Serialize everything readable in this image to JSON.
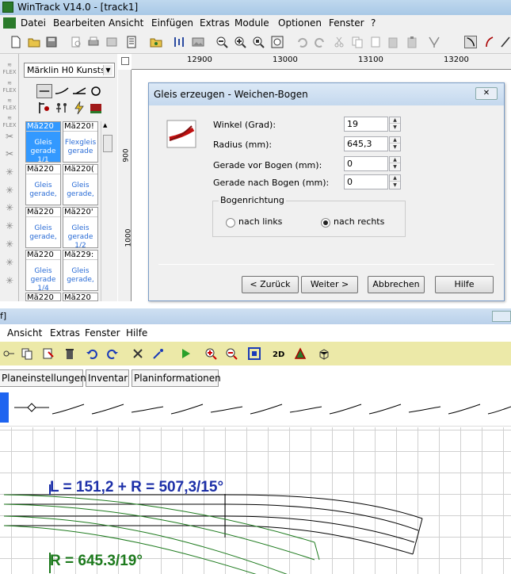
{
  "window": {
    "title": "WinTrack  V14.0 - [track1]"
  },
  "menubar": {
    "items": [
      "Datei",
      "Bearbeiten",
      "Ansicht",
      "Einfügen",
      "Extras",
      "Module",
      "Optionen",
      "Fenster",
      "?"
    ]
  },
  "library": {
    "combo_value": "Märklin H0 Kunstst",
    "tiles": [
      {
        "name": "Mä220",
        "desc": "Gleis gerade 1/1"
      },
      {
        "name": "Mä220!",
        "desc": "Flexgleis gerade"
      },
      {
        "name": "Mä220",
        "desc": "Gleis gerade,"
      },
      {
        "name": "Mä220(",
        "desc": "Gleis gerade,"
      },
      {
        "name": "Mä220",
        "desc": "Gleis gerade,"
      },
      {
        "name": "Mä220'",
        "desc": "Gleis gerade 1/2"
      },
      {
        "name": "Mä220",
        "desc": "Gleis gerade 1/4"
      },
      {
        "name": "Mä229:",
        "desc": "Gleis gerade,"
      },
      {
        "name": "Mä220",
        "desc": ""
      },
      {
        "name": "Mä220",
        "desc": ""
      }
    ]
  },
  "ruler": {
    "h": [
      "12900",
      "13000",
      "13100",
      "13200"
    ],
    "v": [
      "900",
      "1000"
    ]
  },
  "dialog": {
    "title": "Gleis erzeugen - Weichen-Bogen",
    "fields": [
      {
        "label": "Winkel (Grad):",
        "value": "19"
      },
      {
        "label": "Radius (mm):",
        "value": "645,3"
      },
      {
        "label": "Gerade vor Bogen (mm):",
        "value": "0"
      },
      {
        "label": "Gerade nach Bogen (mm):",
        "value": "0"
      }
    ],
    "group_label": "Bogenrichtung",
    "radio_left": "nach links",
    "radio_right": "nach rechts",
    "radio_selected": "nach rechts",
    "buttons": {
      "back": "< Zurück",
      "next": "Weiter >",
      "cancel": "Abbrechen",
      "help": "Hilfe"
    }
  },
  "window2": {
    "title_fragment": "f]"
  },
  "menu2": {
    "items": [
      "Ansicht",
      "Extras",
      "Fenster",
      "Hilfe"
    ]
  },
  "tabs": [
    "Planeinstellungen",
    "Inventar",
    "Planinformationen"
  ],
  "canvas": {
    "label_blue": "L = 151,2 + R = 507,3/15°",
    "label_green": "R = 645.3/19°"
  }
}
